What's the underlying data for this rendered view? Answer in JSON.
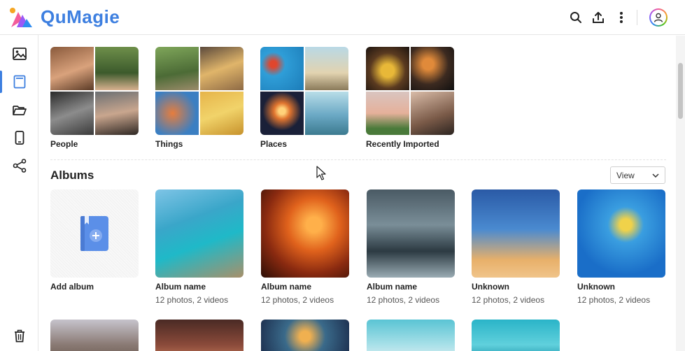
{
  "app": {
    "name": "QuMagie"
  },
  "header": {
    "icons": [
      "search-icon",
      "upload-icon",
      "more-vertical-icon",
      "user-avatar-icon"
    ]
  },
  "sidebar": {
    "items": [
      {
        "name": "photos",
        "icon": "image-icon"
      },
      {
        "name": "albums",
        "icon": "album-icon",
        "active": true
      },
      {
        "name": "folders",
        "icon": "folder-icon"
      },
      {
        "name": "devices",
        "icon": "phone-icon"
      },
      {
        "name": "shared",
        "icon": "share-icon"
      }
    ],
    "bottom": {
      "name": "trash",
      "icon": "trash-icon"
    }
  },
  "categories": [
    {
      "label": "People"
    },
    {
      "label": "Things"
    },
    {
      "label": "Places"
    },
    {
      "label": "Recently Imported"
    }
  ],
  "albums_section": {
    "title": "Albums",
    "view_label": "View"
  },
  "albums": [
    {
      "name": "Add album",
      "count": ""
    },
    {
      "name": "Album name",
      "count": "12 photos, 2 videos"
    },
    {
      "name": "Album name",
      "count": "12 photos, 2 videos"
    },
    {
      "name": "Album name",
      "count": "12 photos, 2 videos"
    },
    {
      "name": "Unknown",
      "count": "12 photos, 2 videos"
    },
    {
      "name": "Unknown",
      "count": "12 photos, 2 videos"
    }
  ],
  "colors": {
    "accent": "#3d7fe0",
    "brand": "#3d7fe0"
  }
}
